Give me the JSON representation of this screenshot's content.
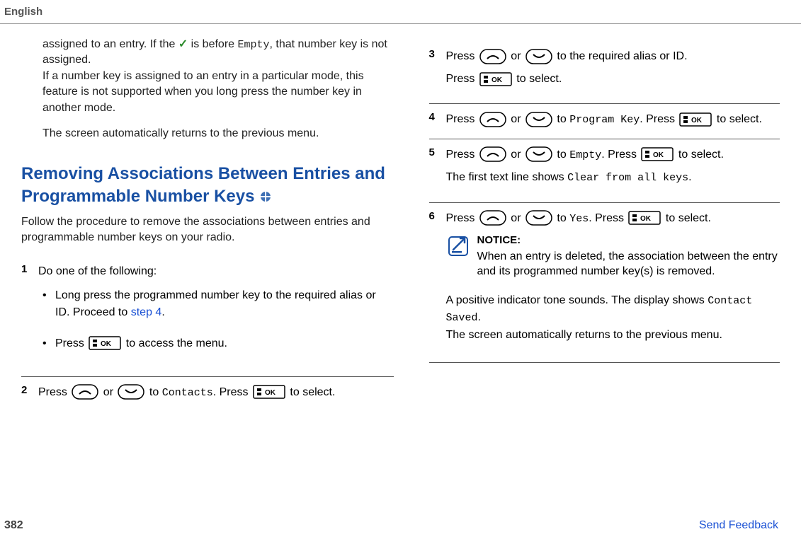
{
  "header": {
    "language": "English"
  },
  "left": {
    "intro1": {
      "pre": "assigned to an entry. If the ",
      "check": "✓",
      "mid": " is before ",
      "empty": "Empty",
      "post1": ", that number key is not assigned.",
      "line2": "If a number key is assigned to an entry in a particular mode, this feature is not supported when you long press the number key in another mode."
    },
    "intro2": "The screen automatically returns to the previous menu.",
    "heading": "Removing Associations Between Entries and Programmable Number Keys",
    "subtext": "Follow the procedure to remove the associations between entries and programmable number keys on your radio.",
    "step1": {
      "num": "1",
      "lead": "Do one of the following:",
      "bullet1a": "Long press the programmed number key to the required alias or ID. Proceed to ",
      "bullet1b": "step 4",
      "bullet1c": ".",
      "bullet2a": "Press ",
      "bullet2b": " to access the menu."
    },
    "step2": {
      "num": "2",
      "a": "Press ",
      "b": " or ",
      "c": " to ",
      "d": "Contacts",
      "e": ". Press ",
      "f": " to select."
    }
  },
  "right": {
    "step3": {
      "num": "3",
      "line1a": "Press ",
      "line1b": " or ",
      "line1c": " to the required alias or ID.",
      "line2a": "Press ",
      "line2b": " to select."
    },
    "step4": {
      "num": "4",
      "a": "Press ",
      "b": " or ",
      "c": " to ",
      "d": "Program Key",
      "e": ". Press ",
      "f": " to select."
    },
    "step5": {
      "num": "5",
      "a": "Press ",
      "b": " or ",
      "c": " to ",
      "d": "Empty",
      "e": ". Press ",
      "f": " to select.",
      "line2a": "The first text line shows ",
      "line2b": "Clear from all keys",
      "line2c": "."
    },
    "step6": {
      "num": "6",
      "a": "Press ",
      "b": " or ",
      "c": " to ",
      "d": "Yes",
      "e": ". Press ",
      "f": " to select.",
      "notice_label": "NOTICE:",
      "notice_text": "When an entry is deleted, the association between the entry and its programmed number key(s) is removed.",
      "tail1a": "A positive indicator tone sounds. The display shows ",
      "tail1b": "Contact Saved",
      "tail1c": ".",
      "tail2": "The screen automatically returns to the previous menu."
    }
  },
  "footer": {
    "page": "382",
    "feedback": "Send Feedback"
  }
}
